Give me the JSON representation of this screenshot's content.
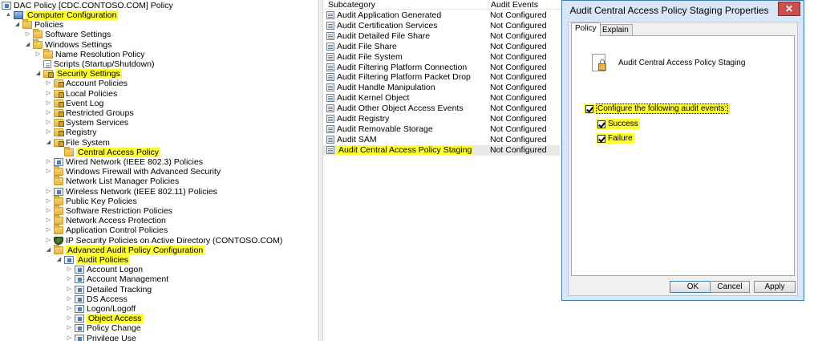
{
  "tree": {
    "root": "DAC Policy [CDC.CONTOSO.COM] Policy",
    "nodes": [
      {
        "label": "Computer Configuration",
        "icon": "computer-icon",
        "toggle": "▲",
        "highlight": true
      },
      {
        "label": "Policies",
        "icon": "folder-icon",
        "toggle": "◢",
        "highlight": false
      },
      {
        "label": "Software Settings",
        "icon": "folder-icon",
        "toggle": "▷",
        "highlight": false
      },
      {
        "label": "Windows Settings",
        "icon": "folder-icon",
        "toggle": "◢",
        "highlight": false
      },
      {
        "label": "Name Resolution Policy",
        "icon": "folder-icon",
        "toggle": "▷",
        "highlight": false
      },
      {
        "label": "Scripts (Startup/Shutdown)",
        "icon": "page-icon",
        "toggle": "",
        "highlight": false
      },
      {
        "label": "Security Settings",
        "icon": "lock-folder-icon",
        "toggle": "◢",
        "highlight": true
      },
      {
        "label": "Account Policies",
        "icon": "lock-folder-icon",
        "toggle": "▷",
        "highlight": false
      },
      {
        "label": "Local Policies",
        "icon": "lock-folder-icon",
        "toggle": "▷",
        "highlight": false
      },
      {
        "label": "Event Log",
        "icon": "lock-folder-icon",
        "toggle": "▷",
        "highlight": false
      },
      {
        "label": "Restricted Groups",
        "icon": "lock-folder-icon",
        "toggle": "▷",
        "highlight": false
      },
      {
        "label": "System Services",
        "icon": "lock-folder-icon",
        "toggle": "▷",
        "highlight": false
      },
      {
        "label": "Registry",
        "icon": "lock-folder-icon",
        "toggle": "▷",
        "highlight": false
      },
      {
        "label": "File System",
        "icon": "lock-folder-icon",
        "toggle": "◢",
        "highlight": false
      },
      {
        "label": "Central Access Policy",
        "icon": "folder-icon",
        "toggle": "",
        "highlight": true
      },
      {
        "label": "Wired Network (IEEE 802.3) Policies",
        "icon": "policy-icon",
        "toggle": "▷",
        "highlight": false
      },
      {
        "label": "Windows Firewall with Advanced Security",
        "icon": "folder-icon",
        "toggle": "▷",
        "highlight": false
      },
      {
        "label": "Network List Manager Policies",
        "icon": "folder-icon",
        "toggle": "",
        "highlight": false
      },
      {
        "label": "Wireless Network (IEEE 802.11) Policies",
        "icon": "policy-icon",
        "toggle": "▷",
        "highlight": false
      },
      {
        "label": "Public Key Policies",
        "icon": "folder-icon",
        "toggle": "▷",
        "highlight": false
      },
      {
        "label": "Software Restriction Policies",
        "icon": "folder-icon",
        "toggle": "▷",
        "highlight": false
      },
      {
        "label": "Network Access Protection",
        "icon": "folder-icon",
        "toggle": "▷",
        "highlight": false
      },
      {
        "label": "Application Control Policies",
        "icon": "folder-icon",
        "toggle": "▷",
        "highlight": false
      },
      {
        "label": "IP Security Policies on Active Directory (CONTOSO.COM)",
        "icon": "shield-icon",
        "toggle": "▷",
        "highlight": false
      },
      {
        "label": "Advanced Audit Policy Configuration",
        "icon": "folder-icon",
        "toggle": "◢",
        "highlight": true
      },
      {
        "label": "Audit Policies",
        "icon": "policy-icon",
        "toggle": "◢",
        "highlight": true
      },
      {
        "label": "Account Logon",
        "icon": "policy-icon",
        "toggle": "▷",
        "highlight": false
      },
      {
        "label": "Account Management",
        "icon": "policy-icon",
        "toggle": "▷",
        "highlight": false
      },
      {
        "label": "Detailed Tracking",
        "icon": "policy-icon",
        "toggle": "▷",
        "highlight": false
      },
      {
        "label": "DS Access",
        "icon": "policy-icon",
        "toggle": "▷",
        "highlight": false
      },
      {
        "label": "Logon/Logoff",
        "icon": "policy-icon",
        "toggle": "▷",
        "highlight": false
      },
      {
        "label": "Object Access",
        "icon": "policy-icon",
        "toggle": "▷",
        "highlight": true
      },
      {
        "label": "Policy Change",
        "icon": "policy-icon",
        "toggle": "▷",
        "highlight": false
      },
      {
        "label": "Privilege Use",
        "icon": "policy-icon",
        "toggle": "▷",
        "highlight": false
      }
    ]
  },
  "list": {
    "columns": [
      "Subcategory",
      "Audit Events"
    ],
    "rows": [
      {
        "name": "Audit Application Generated",
        "value": "Not Configured",
        "highlight": false
      },
      {
        "name": "Audit Certification Services",
        "value": "Not Configured",
        "highlight": false
      },
      {
        "name": "Audit Detailed File Share",
        "value": "Not Configured",
        "highlight": false
      },
      {
        "name": "Audit File Share",
        "value": "Not Configured",
        "highlight": false
      },
      {
        "name": "Audit File System",
        "value": "Not Configured",
        "highlight": false
      },
      {
        "name": "Audit Filtering Platform Connection",
        "value": "Not Configured",
        "highlight": false
      },
      {
        "name": "Audit Filtering Platform Packet Drop",
        "value": "Not Configured",
        "highlight": false
      },
      {
        "name": "Audit Handle Manipulation",
        "value": "Not Configured",
        "highlight": false
      },
      {
        "name": "Audit Kernel Object",
        "value": "Not Configured",
        "highlight": false
      },
      {
        "name": "Audit Other Object Access Events",
        "value": "Not Configured",
        "highlight": false
      },
      {
        "name": "Audit Registry",
        "value": "Not Configured",
        "highlight": false
      },
      {
        "name": "Audit Removable Storage",
        "value": "Not Configured",
        "highlight": false
      },
      {
        "name": "Audit SAM",
        "value": "Not Configured",
        "highlight": false
      },
      {
        "name": "Audit Central Access Policy Staging",
        "value": "Not Configured",
        "highlight": true
      }
    ]
  },
  "dialog": {
    "title": "Audit Central Access Policy Staging Properties",
    "close_label": "✕",
    "tabs": {
      "policy": "Policy",
      "explain": "Explain"
    },
    "heading": "Audit Central Access Policy Staging",
    "configure_label": "Configure the following audit events:",
    "configure_checked": true,
    "success_label": "Success",
    "success_checked": true,
    "failure_label": "Failure",
    "failure_checked": true,
    "buttons": {
      "ok": "OK",
      "cancel": "Cancel",
      "apply": "Apply"
    },
    "accent_color": "#3c7fb1",
    "highlight_color": "#ffff33"
  }
}
